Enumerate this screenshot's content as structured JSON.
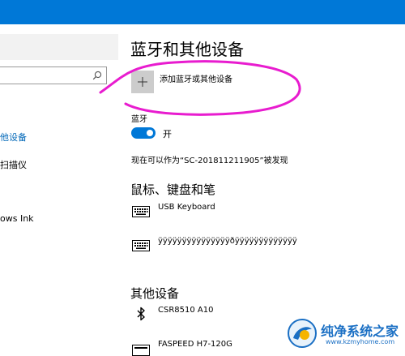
{
  "window": {
    "title_bar_color": "#0078d7"
  },
  "sidebar": {
    "search_placeholder": "",
    "items": [
      {
        "label": "他设备",
        "active": true
      },
      {
        "label": "扫描仪",
        "active": false
      },
      {
        "label": "ows Ink",
        "active": false
      }
    ]
  },
  "main": {
    "page_title": "蓝牙和其他设备",
    "add_device_label": "添加蓝牙或其他设备",
    "bluetooth": {
      "label": "蓝牙",
      "state_label": "开",
      "enabled": true,
      "discoverable_text": "现在可以作为“SC-201811211905”被发现"
    },
    "mouse_keyboard_section": {
      "title": "鼠标、键盘和笔",
      "devices": [
        {
          "name": "USB Keyboard",
          "icon": "keyboard-icon"
        },
        {
          "name": "ÿÿÿÿÿÿÿÿÿÿÿÿÿÿÿðÿÿÿÿÿÿÿÿÿÿÿÿÿ",
          "icon": "keyboard-icon"
        }
      ]
    },
    "other_devices_section": {
      "title": "其他设备",
      "devices": [
        {
          "name": "CSR8510 A10",
          "icon": "bluetooth-icon"
        },
        {
          "name": "FASPEED H7-120G",
          "icon": "drive-icon"
        }
      ]
    }
  },
  "watermark": {
    "title": "纯净系统之家",
    "url": "www.kzmyhome.com"
  },
  "colors": {
    "accent": "#0078d7",
    "annotation": "#e81ccf"
  }
}
